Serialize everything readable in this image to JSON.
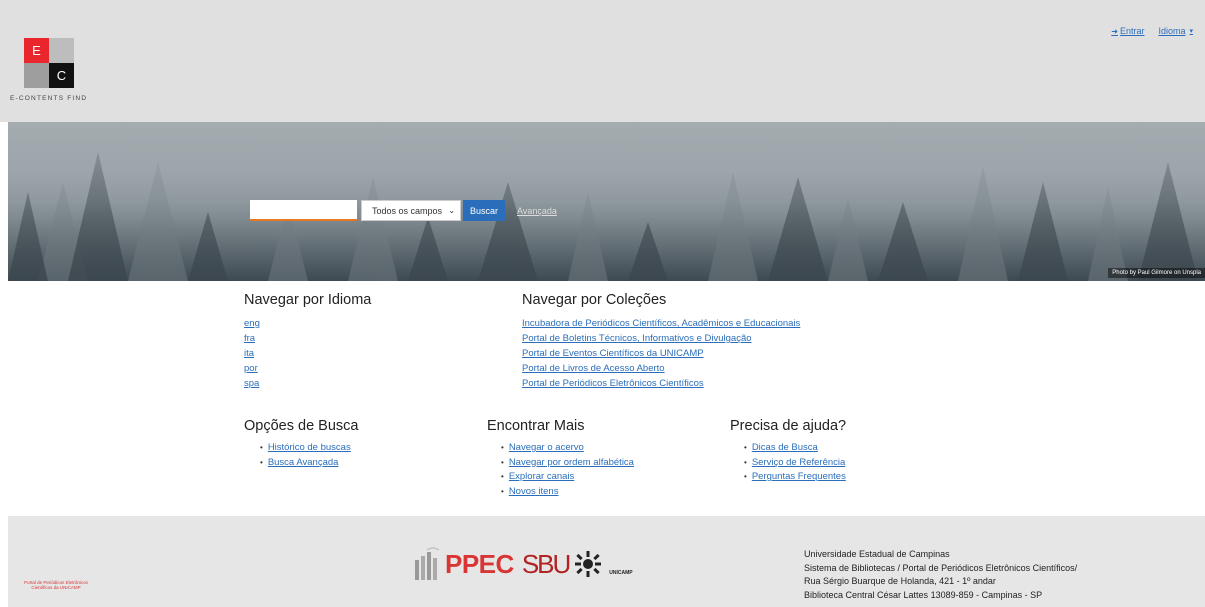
{
  "header": {
    "logo_letters": {
      "top": "E",
      "bottom": "C"
    },
    "logo_text": "E-CONTENTS FIND",
    "login_label": "Entrar",
    "language_label": "Idioma"
  },
  "hero": {
    "search": {
      "input_value": "",
      "select_value": "Todos os campos",
      "button_label": "Buscar",
      "advanced_label": "Avançada"
    },
    "photo_credit": "Photo by Paul Gilmore on Unspla"
  },
  "browse_language": {
    "title": "Navegar por Idioma",
    "items": [
      "eng",
      "fra",
      "ita",
      "por",
      "spa"
    ]
  },
  "browse_collections": {
    "title": "Navegar por Coleções",
    "items": [
      "Incubadora de Periódicos Científicos, Acadêmicos e Educacionais",
      "Portal de Boletins Técnicos, Informativos e Divulgação",
      "Portal de Eventos Científicos da UNICAMP",
      "Portal de Livros de Acesso Aberto",
      "Portal de Periódicos Eletrônicos Científicos"
    ]
  },
  "search_options": {
    "title": "Opções de Busca",
    "items": [
      "Histórico de buscas",
      "Busca Avançada"
    ]
  },
  "find_more": {
    "title": "Encontrar Mais",
    "items": [
      "Navegar o acervo",
      "Navegar por ordem alfabética",
      "Explorar canais",
      "Novos itens"
    ]
  },
  "need_help": {
    "title": "Precisa de ajuda?",
    "items": [
      "Dicas de Busca",
      "Serviço de Referência",
      "Perguntas Frequentes"
    ]
  },
  "footer": {
    "logos": {
      "ppec": "PPEC",
      "ppec_sub": "Portal de Periódicos Eletrônicos Científicos da UNICAMP",
      "sbu": "SBU",
      "unicamp": "UNICAMP"
    },
    "address_lines": [
      "Universidade Estadual de Campinas",
      "Sistema de Bibliotecas / Portal de Periódicos Eletrônicos Científicos/",
      "Rua Sérgio Buarque de Holanda, 421 - 1º andar",
      "Biblioteca Central César Lattes 13089-859 - Campinas - SP"
    ]
  },
  "colors": {
    "accent": "#2a6ebb",
    "logo_red": "#e8262b",
    "input_underline": "#e87722",
    "ppec_red": "#d93534"
  }
}
